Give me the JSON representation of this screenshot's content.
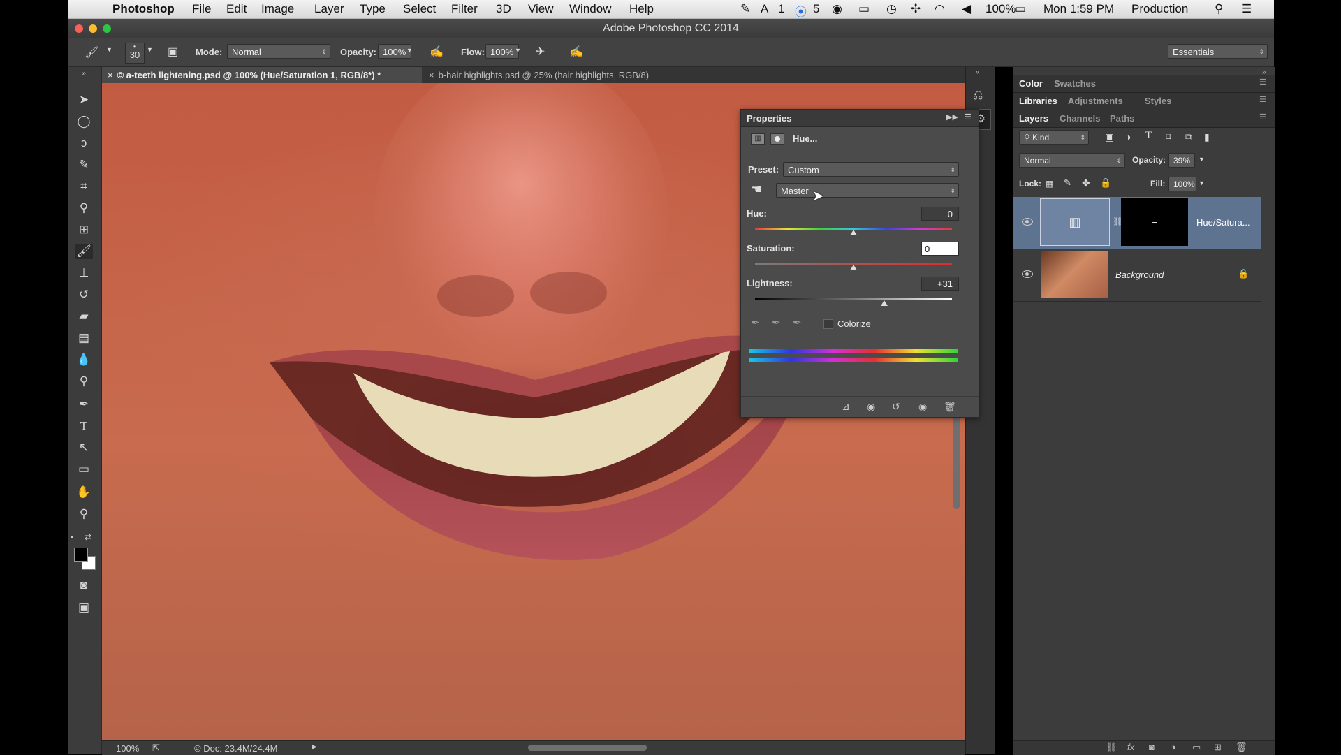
{
  "menubar": {
    "apple_icon": "apple-icon",
    "app": "Photoshop",
    "items": [
      "File",
      "Edit",
      "Image",
      "Layer",
      "Type",
      "Select",
      "Filter",
      "3D",
      "View",
      "Window",
      "Help"
    ],
    "status": {
      "ai_count": "1",
      "cc_count": "5",
      "battery": "100%",
      "clock": "Mon 1:59 PM",
      "user": "Production"
    }
  },
  "window": {
    "title": "Adobe Photoshop CC 2014"
  },
  "options": {
    "brush_size": "30",
    "mode_label": "Mode:",
    "mode_value": "Normal",
    "opacity_label": "Opacity:",
    "opacity_value": "100%",
    "flow_label": "Flow:",
    "flow_value": "100%",
    "workspace": "Essentials"
  },
  "tabs": [
    {
      "label": "© a-teeth lightening.psd @ 100% (Hue/Saturation 1, RGB/8*) *",
      "active": true
    },
    {
      "label": "b-hair highlights.psd @ 25% (hair highlights, RGB/8)",
      "active": false
    }
  ],
  "status_bar": {
    "zoom": "100%",
    "doc": "© Doc: 23.4M/24.4M"
  },
  "properties": {
    "title": "Properties",
    "adjustment": "Hue...",
    "preset_label": "Preset:",
    "preset_value": "Custom",
    "channel": "Master",
    "hue_label": "Hue:",
    "hue_value": "0",
    "saturation_label": "Saturation:",
    "saturation_value": "0",
    "lightness_label": "Lightness:",
    "lightness_value": "+31",
    "colorize_label": "Colorize",
    "colorize_checked": false,
    "slider_levels": {
      "hue": 0,
      "saturation": 0,
      "lightness": 31
    }
  },
  "panels": {
    "group1_tabs": [
      "Color",
      "Swatches"
    ],
    "group2_tabs": [
      "Libraries",
      "Adjustments",
      "Styles"
    ],
    "group3_tabs": [
      "Layers",
      "Channels",
      "Paths"
    ],
    "filter": "Kind",
    "blend_mode": "Normal",
    "opacity_label": "Opacity:",
    "opacity_value": "39%",
    "lock_label": "Lock:",
    "fill_label": "Fill:",
    "fill_value": "100%",
    "layers": [
      {
        "name": "Hue/Satura...",
        "selected": true
      },
      {
        "name": "Background",
        "selected": false
      }
    ]
  },
  "colors": {
    "accent": "#5d7390",
    "panel": "#3c3c3c",
    "skin": "#c86b4e"
  }
}
